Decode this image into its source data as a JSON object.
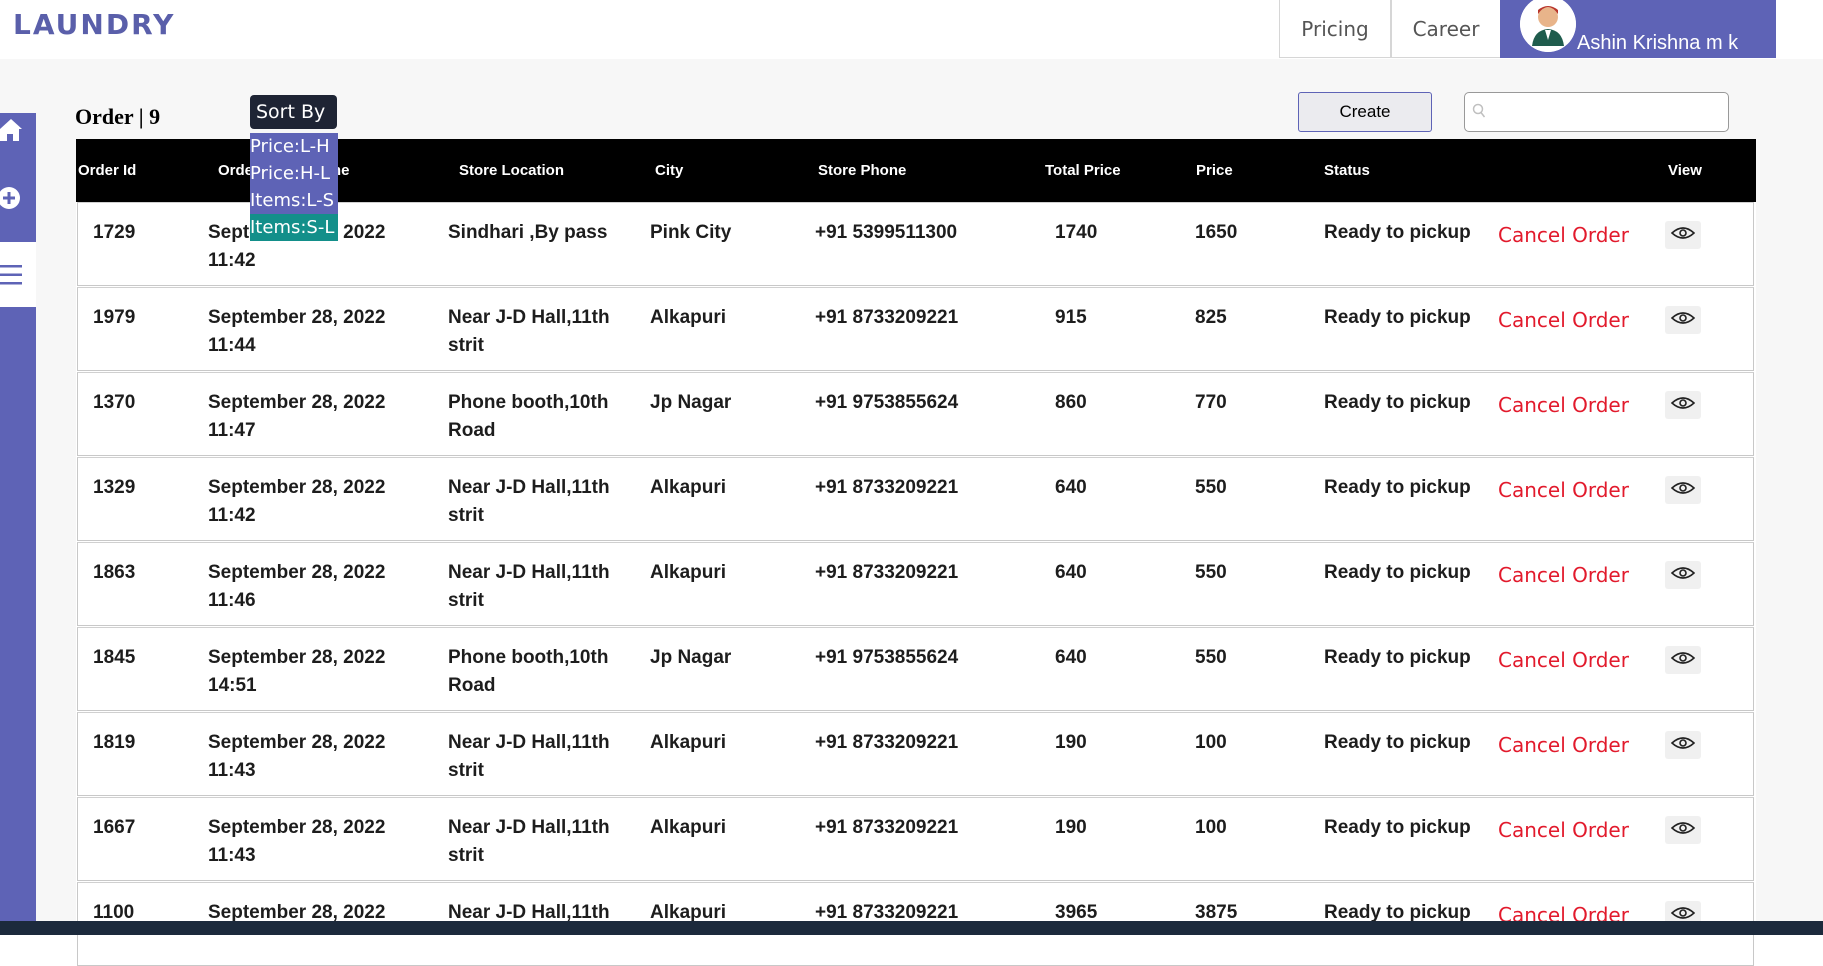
{
  "header": {
    "logo": "LAUNDRY",
    "nav": [
      "Pricing",
      "Career"
    ],
    "user_name": "Ashin Krishna m k"
  },
  "sidebar": {
    "icons": [
      "home-icon",
      "add-circle-icon",
      "list-icon"
    ]
  },
  "toolbar": {
    "order_label": "Order | 9",
    "sort_label": "Sort By",
    "sort_options": [
      "Price:L-H",
      "Price:H-L",
      "Items:L-S",
      "Items:S-L"
    ],
    "create_label": "Create",
    "search_placeholder": ""
  },
  "table": {
    "headers": [
      "Order Id",
      "Order Date & Time",
      "Store Location",
      "City",
      "Store Phone",
      "Total Price",
      "Price",
      "Status",
      "View"
    ],
    "rows": [
      {
        "id": "1729",
        "date": "September 28, 2022",
        "time": "11:42",
        "location": "Sindhari ,By pass",
        "city": "Pink City",
        "phone": "+91 5399511300",
        "total": "1740",
        "price": "1650",
        "status": "Ready to pickup",
        "action": "Cancel Order"
      },
      {
        "id": "1979",
        "date": "September 28, 2022",
        "time": "11:44",
        "location": "Near J-D Hall,11th strit",
        "city": "Alkapuri",
        "phone": "+91 8733209221",
        "total": "915",
        "price": "825",
        "status": "Ready to pickup",
        "action": "Cancel Order"
      },
      {
        "id": "1370",
        "date": "September 28, 2022",
        "time": "11:47",
        "location": "Phone booth,10th Road",
        "city": "Jp Nagar",
        "phone": "+91 9753855624",
        "total": "860",
        "price": "770",
        "status": "Ready to pickup",
        "action": "Cancel Order"
      },
      {
        "id": "1329",
        "date": "September 28, 2022",
        "time": "11:42",
        "location": "Near J-D Hall,11th strit",
        "city": "Alkapuri",
        "phone": "+91 8733209221",
        "total": "640",
        "price": "550",
        "status": "Ready to pickup",
        "action": "Cancel Order"
      },
      {
        "id": "1863",
        "date": "September 28, 2022",
        "time": "11:46",
        "location": "Near J-D Hall,11th strit",
        "city": "Alkapuri",
        "phone": "+91 8733209221",
        "total": "640",
        "price": "550",
        "status": "Ready to pickup",
        "action": "Cancel Order"
      },
      {
        "id": "1845",
        "date": "September 28, 2022",
        "time": "14:51",
        "location": "Phone booth,10th Road",
        "city": "Jp Nagar",
        "phone": "+91 9753855624",
        "total": "640",
        "price": "550",
        "status": "Ready to pickup",
        "action": "Cancel Order"
      },
      {
        "id": "1819",
        "date": "September 28, 2022",
        "time": "11:43",
        "location": "Near J-D Hall,11th strit",
        "city": "Alkapuri",
        "phone": "+91 8733209221",
        "total": "190",
        "price": "100",
        "status": "Ready to pickup",
        "action": "Cancel Order"
      },
      {
        "id": "1667",
        "date": "September 28, 2022",
        "time": "11:43",
        "location": "Near J-D Hall,11th strit",
        "city": "Alkapuri",
        "phone": "+91 8733209221",
        "total": "190",
        "price": "100",
        "status": "Ready to pickup",
        "action": "Cancel Order"
      },
      {
        "id": "1100",
        "date": "September 28, 2022",
        "time": "",
        "location": "Near J-D Hall,11th",
        "city": "Alkapuri",
        "phone": "+91 8733209221",
        "total": "3965",
        "price": "3875",
        "status": "Ready to pickup",
        "action": "Cancel Order"
      }
    ]
  },
  "colors": {
    "brand": "#5e63b6",
    "header_bg": "#000000",
    "cancel": "#e21a2c",
    "sort_highlight": "#138f8a"
  }
}
